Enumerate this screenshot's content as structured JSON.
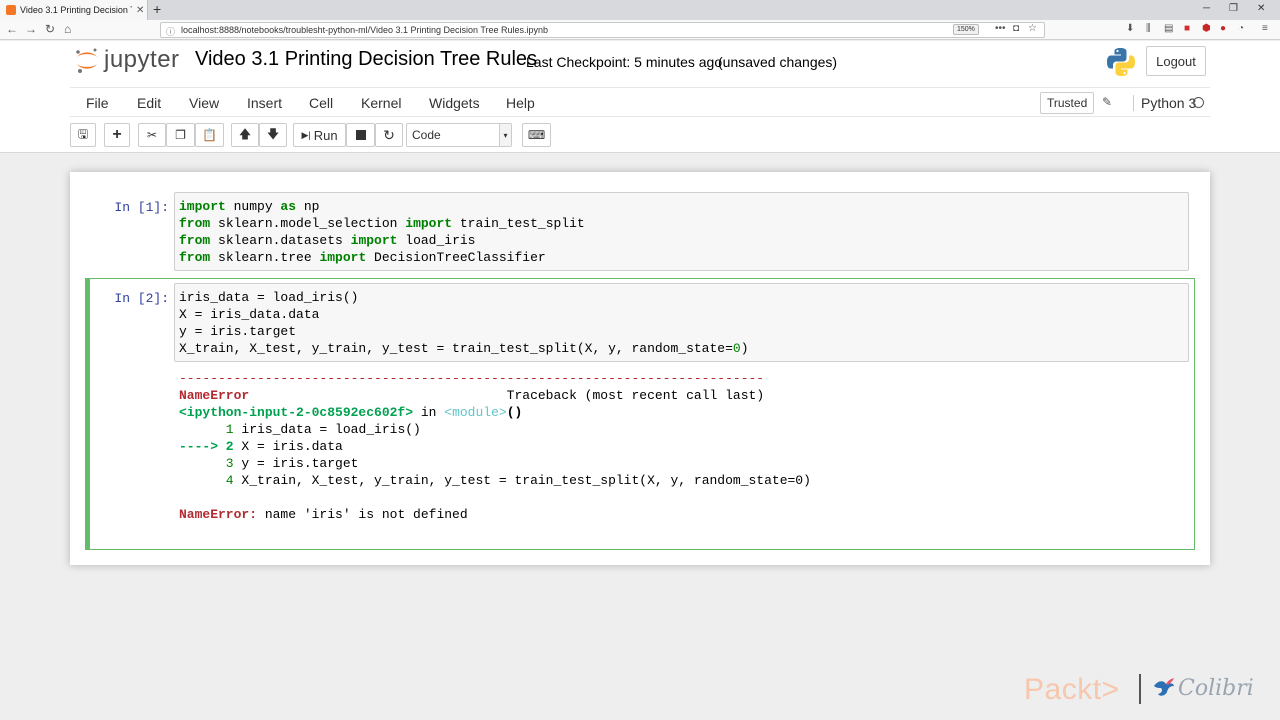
{
  "browser": {
    "tab_title": "Video 3.1 Printing Decision Tre",
    "url": "localhost:8888/notebooks/troublesht-python-ml/Video 3.1 Printing Decision Tree Rules.ipynb",
    "zoom": "150%"
  },
  "header": {
    "logo_text": "jupyter",
    "notebook_title": "Video 3.1 Printing Decision Tree Rules",
    "checkpoint": "Last Checkpoint: 5 minutes ago",
    "status": "(unsaved changes)",
    "logout_label": "Logout"
  },
  "menu": {
    "items": [
      "File",
      "Edit",
      "View",
      "Insert",
      "Cell",
      "Kernel",
      "Widgets",
      "Help"
    ],
    "trusted_label": "Trusted",
    "kernel_name": "Python 3"
  },
  "toolbar": {
    "run_label": "Run",
    "cell_type": "Code"
  },
  "cells": [
    {
      "prompt": "In [1]:",
      "lines": [
        "import numpy as np",
        "from sklearn.model_selection import train_test_split",
        "from sklearn.datasets import load_iris",
        "from sklearn.tree import DecisionTreeClassifier"
      ]
    },
    {
      "prompt": "In [2]:",
      "lines": [
        "iris_data = load_iris()",
        "X = iris_data.data",
        "y = iris.target",
        "X_train, X_test, y_train, y_test = train_test_split(X, y, random_state=0)"
      ],
      "output": {
        "separator": "---------------------------------------------------------------------------",
        "error_name": "NameError",
        "traceback_label": "Traceback (most recent call last)",
        "input_ref": "<ipython-input-2-0c8592ec602f>",
        "in_word": " in ",
        "module": "<module>",
        "call": "()",
        "trace_lines": [
          {
            "marker": "      1 ",
            "code": "iris_data = load_iris()"
          },
          {
            "marker": "----> 2 ",
            "code": "X = iris.data"
          },
          {
            "marker": "      3 ",
            "code": "y = iris.target"
          },
          {
            "marker": "      4 ",
            "code": "X_train, X_test, y_train, y_test = train_test_split(X, y, random_state=0)"
          }
        ],
        "final_error_name": "NameError:",
        "final_error_msg": " name 'iris' is not defined"
      }
    }
  ],
  "watermark": {
    "packt": "Packt>",
    "colibri": "Colibri"
  }
}
